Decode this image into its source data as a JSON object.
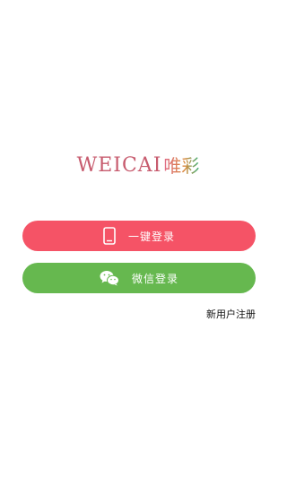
{
  "logo": {
    "latin": "WEICAI",
    "cjk": "唯彩"
  },
  "login": {
    "phone_label": "一键登录",
    "phone_icon": "phone-icon",
    "wechat_label": "微信登录",
    "wechat_icon": "wechat-icon"
  },
  "register": {
    "label": "新用户注册"
  },
  "colors": {
    "phone_button": "#f55366",
    "wechat_button": "#66b84f",
    "logo_text": "#c75b6e"
  }
}
